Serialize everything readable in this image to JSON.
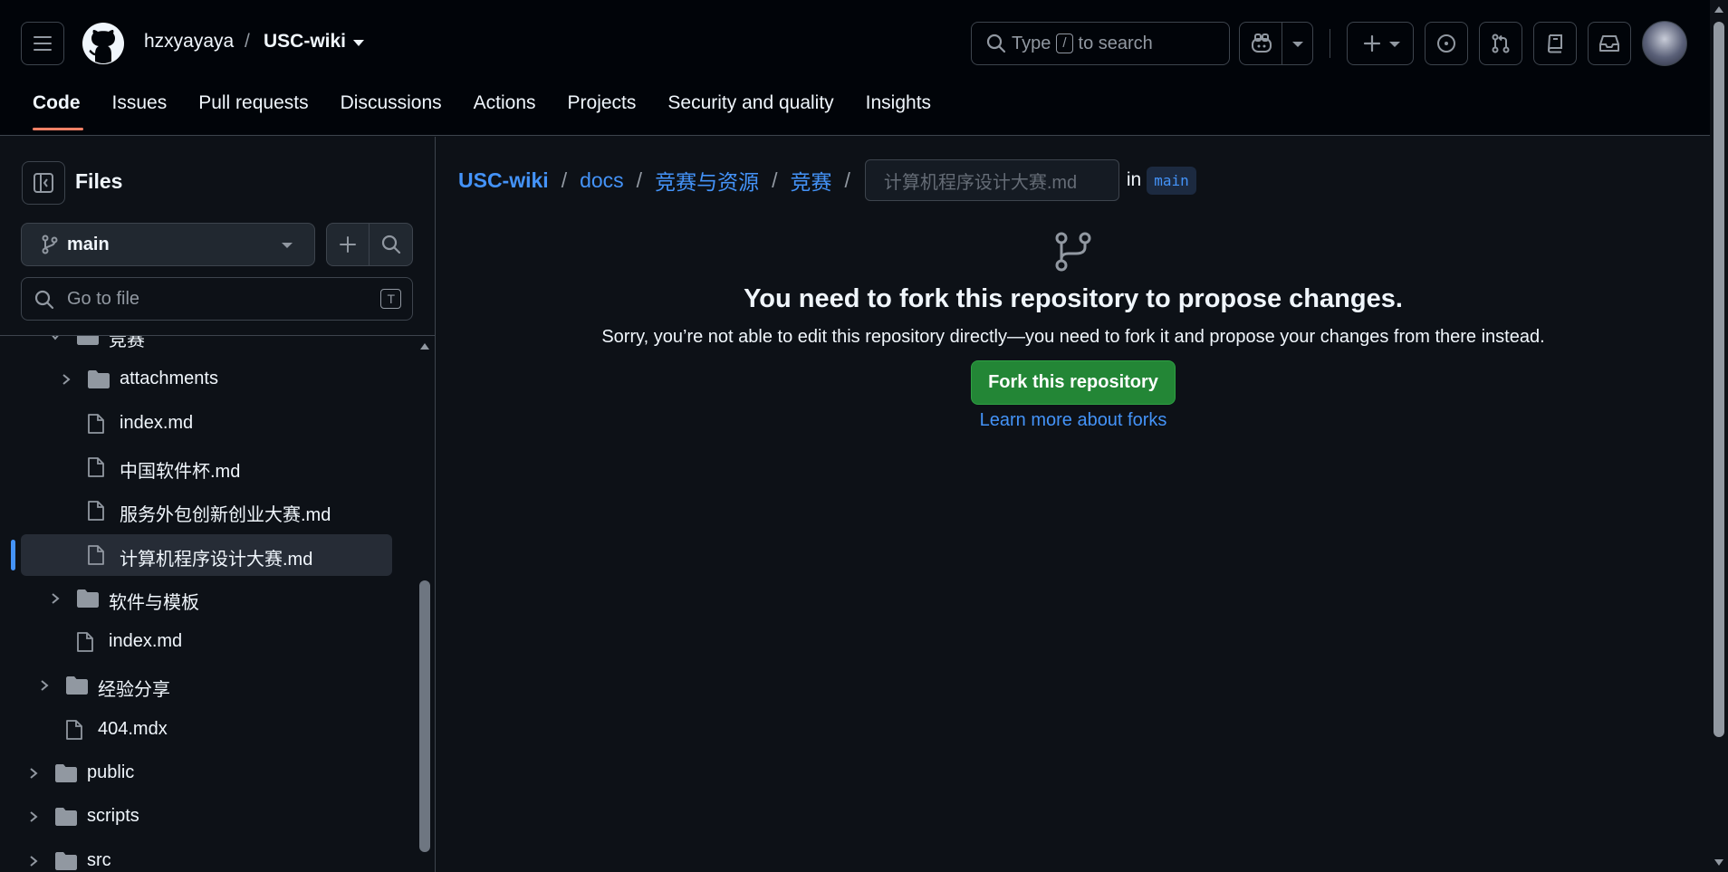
{
  "header": {
    "owner": "hzxyayaya",
    "separator": "/",
    "repo": "USC-wiki",
    "search": {
      "prefix": "Type",
      "key": "/",
      "suffix": "to search"
    }
  },
  "tabs": [
    {
      "label": "Code",
      "active": true
    },
    {
      "label": "Issues"
    },
    {
      "label": "Pull requests"
    },
    {
      "label": "Discussions"
    },
    {
      "label": "Actions"
    },
    {
      "label": "Projects"
    },
    {
      "label": "Security and quality"
    },
    {
      "label": "Insights"
    }
  ],
  "sidebar": {
    "title": "Files",
    "branch": "main",
    "goto_placeholder": "Go to file",
    "goto_key": "T",
    "tree": [
      {
        "label": "竞赛",
        "type": "folder",
        "expanded": true,
        "depth": 2
      },
      {
        "label": "attachments",
        "type": "folder",
        "expanded": false,
        "depth": 3
      },
      {
        "label": "index.md",
        "type": "file",
        "depth": 3
      },
      {
        "label": "中国软件杯.md",
        "type": "file",
        "depth": 3
      },
      {
        "label": "服务外包创新创业大赛.md",
        "type": "file",
        "depth": 3
      },
      {
        "label": "计算机程序设计大赛.md",
        "type": "file",
        "depth": 3,
        "selected": true
      },
      {
        "label": "软件与模板",
        "type": "folder",
        "expanded": false,
        "depth": 2
      },
      {
        "label": "index.md",
        "type": "file",
        "depth": 2
      },
      {
        "label": "经验分享",
        "type": "folder",
        "expanded": false,
        "depth": 1
      },
      {
        "label": "404.mdx",
        "type": "file",
        "depth": 1
      },
      {
        "label": "public",
        "type": "folder",
        "expanded": false,
        "depth": 0
      },
      {
        "label": "scripts",
        "type": "folder",
        "expanded": false,
        "depth": 0
      },
      {
        "label": "src",
        "type": "folder",
        "expanded": false,
        "depth": 0
      }
    ]
  },
  "breadcrumb": {
    "repo": "USC-wiki",
    "parts": [
      "docs",
      "竞赛与资源",
      "竞赛"
    ],
    "sep": "/",
    "filename_placeholder": "计算机程序设计大赛.md",
    "in_label": "in",
    "branch": "main"
  },
  "notice": {
    "title": "You need to fork this repository to propose changes.",
    "body": "Sorry, you’re not able to edit this repository directly—you need to fork it and propose your changes from there instead.",
    "button": "Fork this repository",
    "link": "Learn more about forks"
  },
  "colors": {
    "accent_link": "#4493f8",
    "fork_button": "#238636",
    "active_tab_underline": "#f78166",
    "background": "#0d1117",
    "header_bg": "#010409"
  }
}
